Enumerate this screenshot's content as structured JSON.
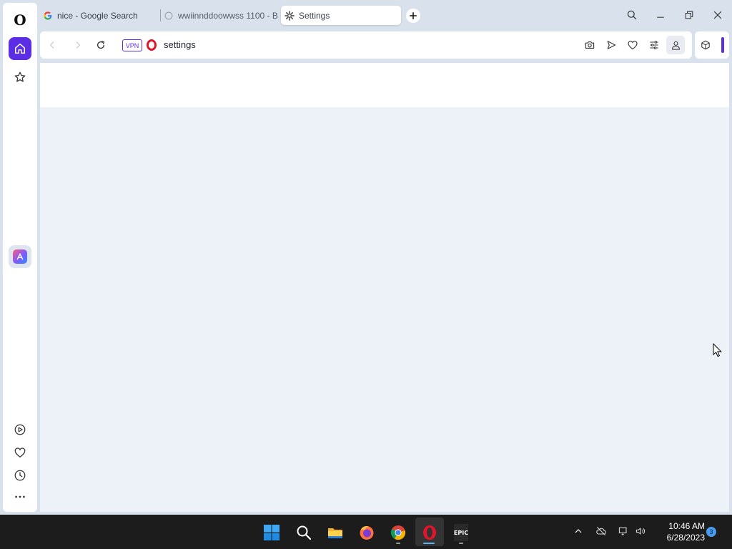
{
  "sidebar": {
    "logo": "O",
    "items": [
      {
        "name": "home",
        "icon": "home-icon"
      },
      {
        "name": "bookmarks",
        "icon": "star-icon"
      },
      {
        "name": "aria",
        "icon": "aria-icon"
      },
      {
        "name": "player",
        "icon": "play-icon"
      },
      {
        "name": "pinboards",
        "icon": "heart-icon"
      },
      {
        "name": "history",
        "icon": "clock-icon"
      },
      {
        "name": "more",
        "icon": "more-icon"
      }
    ]
  },
  "tabs": [
    {
      "title": "nice - Google Search",
      "favicon": "google-icon"
    },
    {
      "title": "wwiinnddoowwss 1100 - B",
      "favicon": "loading-icon"
    },
    {
      "title": "Settings",
      "favicon": "gear-icon",
      "active": true
    }
  ],
  "address_bar": {
    "vpn_label": "VPN",
    "url": "settings"
  },
  "taskbar": {
    "clock_time": "10:46 AM",
    "clock_date": "6/28/2023",
    "notification_count": "3",
    "apps": [
      "start-icon",
      "search-icon",
      "file-explorer-icon",
      "firefox-icon",
      "chrome-icon",
      "opera-icon",
      "epic-games-icon"
    ],
    "epic_label": "EPIC"
  },
  "colors": {
    "accent": "#5b2ee6",
    "page_background": "#edf2f8",
    "frame": "#d9e2ec",
    "taskbar": "#1c1c1c",
    "opera_red": "#e0162b"
  }
}
